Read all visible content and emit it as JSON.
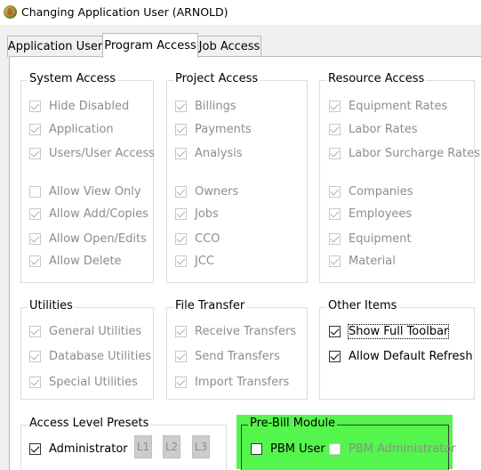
{
  "window": {
    "title": "Changing Application User  (ARNOLD)"
  },
  "tabs": [
    {
      "label": "Application User",
      "active": false
    },
    {
      "label": "Program Access",
      "active": true
    },
    {
      "label": "Job Access",
      "active": false
    }
  ],
  "groups": {
    "system_access": {
      "title": "System Access",
      "items": [
        {
          "label": "Hide Disabled",
          "checked": true,
          "enabled": false
        },
        {
          "label": "Application",
          "checked": true,
          "enabled": false
        },
        {
          "label": "Users/User Access",
          "checked": true,
          "enabled": false
        },
        {
          "label": "Allow View Only",
          "checked": false,
          "enabled": false
        },
        {
          "label": "Allow Add/Copies",
          "checked": true,
          "enabled": false
        },
        {
          "label": "Allow Open/Edits",
          "checked": true,
          "enabled": false
        },
        {
          "label": "Allow Delete",
          "checked": true,
          "enabled": false
        }
      ]
    },
    "project_access": {
      "title": "Project Access",
      "items": [
        {
          "label": "Billings",
          "checked": true,
          "enabled": false
        },
        {
          "label": "Payments",
          "checked": true,
          "enabled": false
        },
        {
          "label": "Analysis",
          "checked": true,
          "enabled": false
        },
        {
          "label": "Owners",
          "checked": true,
          "enabled": false
        },
        {
          "label": "Jobs",
          "checked": true,
          "enabled": false
        },
        {
          "label": "CCO",
          "checked": true,
          "enabled": false
        },
        {
          "label": "JCC",
          "checked": true,
          "enabled": false
        }
      ]
    },
    "resource_access": {
      "title": "Resource Access",
      "items": [
        {
          "label": "Equipment Rates",
          "checked": true,
          "enabled": false
        },
        {
          "label": "Labor Rates",
          "checked": true,
          "enabled": false
        },
        {
          "label": "Labor Surcharge Rates",
          "checked": true,
          "enabled": false
        },
        {
          "label": "Companies",
          "checked": true,
          "enabled": false
        },
        {
          "label": "Employees",
          "checked": true,
          "enabled": false
        },
        {
          "label": "Equipment",
          "checked": true,
          "enabled": false
        },
        {
          "label": "Material",
          "checked": true,
          "enabled": false
        }
      ]
    },
    "utilities": {
      "title": "Utilities",
      "items": [
        {
          "label": "General Utilities",
          "checked": true,
          "enabled": false
        },
        {
          "label": "Database Utilities",
          "checked": true,
          "enabled": false
        },
        {
          "label": "Special Utilities",
          "checked": true,
          "enabled": false
        }
      ]
    },
    "file_transfer": {
      "title": "File Transfer",
      "items": [
        {
          "label": "Receive Transfers",
          "checked": true,
          "enabled": false
        },
        {
          "label": "Send Transfers",
          "checked": true,
          "enabled": false
        },
        {
          "label": "Import Transfers",
          "checked": true,
          "enabled": false
        }
      ]
    },
    "other_items": {
      "title": "Other Items",
      "items": [
        {
          "label": "Show Full Toolbar",
          "checked": true,
          "enabled": true
        },
        {
          "label": "Allow Default Refresh",
          "checked": true,
          "enabled": true
        }
      ]
    },
    "access_level_presets": {
      "title": "Access Level Presets",
      "administrator": {
        "label": "Administrator",
        "checked": true,
        "enabled": true
      },
      "buttons": [
        "L1",
        "L2",
        "L3"
      ]
    },
    "pre_bill_module": {
      "title": "Pre-Bill Module",
      "items": [
        {
          "label": "PBM User",
          "checked": false,
          "enabled": true
        },
        {
          "label": "PBM Administrator",
          "checked": false,
          "enabled": false
        }
      ]
    }
  },
  "colors": {
    "highlight": "#54f54c",
    "disabled_text": "#8d8d8d",
    "window_bg": "#f0f0f0"
  }
}
